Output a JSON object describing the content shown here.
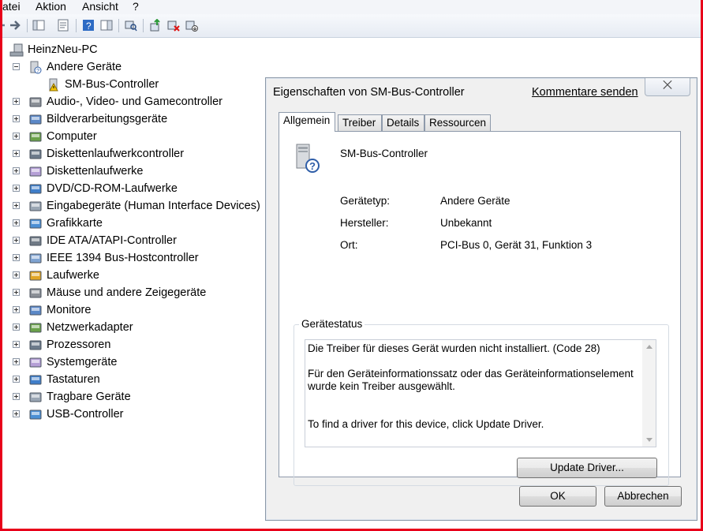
{
  "menu": [
    "atei",
    "Aktion",
    "Ansicht",
    "?"
  ],
  "toolbar_icons": [
    "back-arrow-icon",
    "forward-arrow-icon",
    "console-tree-icon",
    "properties-icon",
    "help-icon",
    "action-pane-icon",
    "scan-hardware-icon",
    "update-driver-icon",
    "disable-device-icon",
    "uninstall-device-icon"
  ],
  "tree": {
    "root": "HeinzNeu-PC",
    "items": [
      {
        "label": "Andere Geräte",
        "expanded": true,
        "icon": "unknown-device-icon"
      },
      {
        "label": "SM-Bus-Controller",
        "child": true,
        "icon": "warning-device-icon"
      },
      {
        "label": "Audio-, Video- und Gamecontroller",
        "icon": "audio-icon"
      },
      {
        "label": "Bildverarbeitungsgeräte",
        "icon": "camera-icon"
      },
      {
        "label": "Computer",
        "icon": "computer-icon"
      },
      {
        "label": "Diskettenlaufwerkcontroller",
        "icon": "floppy-controller-icon"
      },
      {
        "label": "Diskettenlaufwerke",
        "icon": "floppy-drive-icon"
      },
      {
        "label": "DVD/CD-ROM-Laufwerke",
        "icon": "dvd-drive-icon"
      },
      {
        "label": "Eingabegeräte (Human Interface Devices)",
        "icon": "hid-icon"
      },
      {
        "label": "Grafikkarte",
        "icon": "display-adapter-icon"
      },
      {
        "label": "IDE ATA/ATAPI-Controller",
        "icon": "ide-controller-icon"
      },
      {
        "label": "IEEE 1394 Bus-Hostcontroller",
        "icon": "firewire-icon"
      },
      {
        "label": "Laufwerke",
        "icon": "disk-drive-icon"
      },
      {
        "label": "Mäuse und andere Zeigegeräte",
        "icon": "mouse-icon"
      },
      {
        "label": "Monitore",
        "icon": "monitor-icon"
      },
      {
        "label": "Netzwerkadapter",
        "icon": "network-adapter-icon"
      },
      {
        "label": "Prozessoren",
        "icon": "processor-icon"
      },
      {
        "label": "Systemgeräte",
        "icon": "system-devices-icon"
      },
      {
        "label": "Tastaturen",
        "icon": "keyboard-icon"
      },
      {
        "label": "Tragbare Geräte",
        "icon": "portable-device-icon"
      },
      {
        "label": "USB-Controller",
        "icon": "usb-icon"
      }
    ]
  },
  "dialog": {
    "title": "Eigenschaften von SM-Bus-Controller",
    "feedback_link": "Kommentare senden",
    "close_label": "⨉",
    "tabs": [
      "Allgemein",
      "Treiber",
      "Details",
      "Ressourcen"
    ],
    "active_tab": "Allgemein",
    "device_name": "SM-Bus-Controller",
    "props": [
      {
        "key": "Gerätetyp:",
        "value": "Andere Geräte"
      },
      {
        "key": "Hersteller:",
        "value": "Unbekannt"
      },
      {
        "key": "Ort:",
        "value": "PCI-Bus 0, Gerät 31, Funktion 3"
      }
    ],
    "status_title": "Gerätestatus",
    "status_lines": [
      "Die Treiber für dieses Gerät wurden nicht installiert. (Code 28)",
      "Für den Geräteinformationssatz oder das Geräteinformationselement wurde kein Treiber ausgewählt.",
      "To find a driver for this device, click Update Driver."
    ],
    "update_button": "Update Driver...",
    "ok_button": "OK",
    "cancel_button": "Abbrechen"
  },
  "colors": {
    "frame": "#e8001a",
    "dialog_bg": "#f0f0f0"
  }
}
